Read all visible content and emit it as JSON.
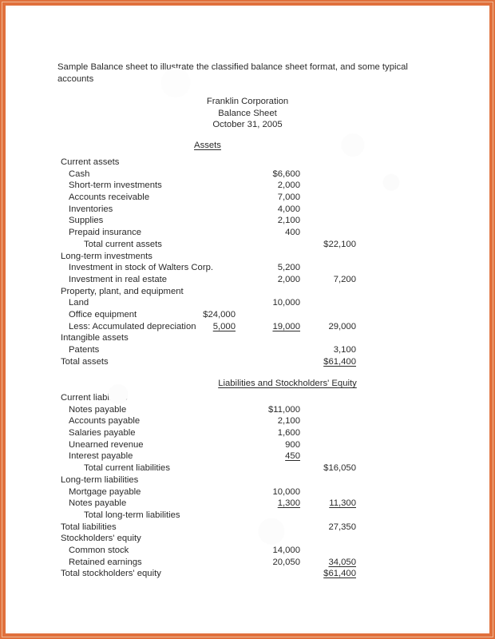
{
  "document": {
    "intro": "Sample Balance sheet to illustrate the classified balance sheet format, and some typical accounts",
    "company": "Franklin Corporation",
    "statement": "Balance Sheet",
    "date": "October 31, 2005",
    "assets_heading": "Assets",
    "liabilities_heading": "Liabilities and Stockholders' Equity"
  },
  "colors": {
    "frame": "#e0703c",
    "page": "#ffffff",
    "text": "#2b2b2b"
  },
  "assets": [
    {
      "label": "Current assets",
      "indent": 0,
      "inner": "",
      "mid": "",
      "right": ""
    },
    {
      "label": "Cash",
      "indent": 1,
      "inner": "",
      "mid": "$6,600",
      "right": ""
    },
    {
      "label": "Short-term investments",
      "indent": 1,
      "inner": "",
      "mid": "2,000",
      "right": ""
    },
    {
      "label": "Accounts receivable",
      "indent": 1,
      "inner": "",
      "mid": "7,000",
      "right": ""
    },
    {
      "label": "Inventories",
      "indent": 1,
      "inner": "",
      "mid": "4,000",
      "right": ""
    },
    {
      "label": "Supplies",
      "indent": 1,
      "inner": "",
      "mid": "2,100",
      "right": ""
    },
    {
      "label": "Prepaid insurance",
      "indent": 1,
      "inner": "",
      "mid": "400",
      "right": ""
    },
    {
      "label": "Total current assets",
      "indent": 2,
      "inner": "",
      "mid": "",
      "right": "$22,100"
    },
    {
      "label": "Long-term investments",
      "indent": 0,
      "inner": "",
      "mid": "",
      "right": ""
    },
    {
      "label": "Investment in stock of Walters Corp.",
      "indent": 1,
      "inner": "",
      "mid": "5,200",
      "right": ""
    },
    {
      "label": "Investment in real estate",
      "indent": 1,
      "inner": "",
      "mid": "2,000",
      "right": "7,200"
    },
    {
      "label": "Property, plant, and equipment",
      "indent": 0,
      "inner": "",
      "mid": "",
      "right": ""
    },
    {
      "label": "Land",
      "indent": 1,
      "inner": "",
      "mid": "10,000",
      "right": ""
    },
    {
      "label": "Office equipment",
      "indent": 1,
      "inner": "$24,000",
      "mid": "",
      "right": ""
    },
    {
      "label": "Less: Accumulated depreciation",
      "indent": 1,
      "inner": "5,000",
      "inner_rule": true,
      "mid": "19,000",
      "mid_rule": true,
      "right": "29,000"
    },
    {
      "label": "Intangible assets",
      "indent": 0,
      "inner": "",
      "mid": "",
      "right": ""
    },
    {
      "label": "Patents",
      "indent": 1,
      "inner": "",
      "mid": "",
      "right": "3,100"
    },
    {
      "label": "Total assets",
      "indent": 0,
      "inner": "",
      "mid": "",
      "right": "$61,400",
      "right_rule": true
    }
  ],
  "liabilities": [
    {
      "label": "Current liabilities",
      "indent": 0,
      "inner": "",
      "mid": "",
      "right": ""
    },
    {
      "label": "Notes payable",
      "indent": 1,
      "inner": "",
      "mid": "$11,000",
      "right": ""
    },
    {
      "label": "Accounts payable",
      "indent": 1,
      "inner": "",
      "mid": "2,100",
      "right": ""
    },
    {
      "label": "Salaries payable",
      "indent": 1,
      "inner": "",
      "mid": "1,600",
      "right": ""
    },
    {
      "label": "Unearned revenue",
      "indent": 1,
      "inner": "",
      "mid": "900",
      "right": ""
    },
    {
      "label": "Interest payable",
      "indent": 1,
      "inner": "",
      "mid": "450",
      "mid_rule": true,
      "right": ""
    },
    {
      "label": "Total current liabilities",
      "indent": 2,
      "inner": "",
      "mid": "",
      "right": "$16,050"
    },
    {
      "label": "Long-term liabilities",
      "indent": 0,
      "inner": "",
      "mid": "",
      "right": ""
    },
    {
      "label": "Mortgage payable",
      "indent": 1,
      "inner": "",
      "mid": "10,000",
      "right": ""
    },
    {
      "label": "Notes payable",
      "indent": 1,
      "inner": "",
      "mid": "1,300",
      "mid_rule": true,
      "right": "11,300",
      "right_rule": true
    },
    {
      "label": "Total long-term liabilities",
      "indent": 2,
      "inner": "",
      "mid": "",
      "right": ""
    },
    {
      "label": "Total liabilities",
      "indent": 0,
      "inner": "",
      "mid": "",
      "right": "27,350"
    },
    {
      "label": "Stockholders' equity",
      "indent": 0,
      "inner": "",
      "mid": "",
      "right": ""
    },
    {
      "label": "Common stock",
      "indent": 1,
      "inner": "",
      "mid": "14,000",
      "right": ""
    },
    {
      "label": "Retained earnings",
      "indent": 1,
      "inner": "",
      "mid": "20,050",
      "right": "34,050",
      "right_rule": true
    },
    {
      "label": "Total stockholders' equity",
      "indent": 0,
      "inner": "",
      "mid": "",
      "right": "$61,400",
      "right_rule": true
    }
  ]
}
